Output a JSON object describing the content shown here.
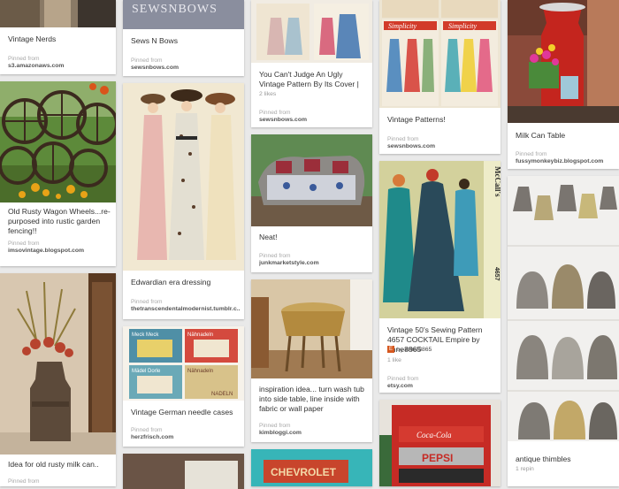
{
  "pins": {
    "vintage_nerds": {
      "description": "Vintage Nerds",
      "pinned_from": "Pinned from",
      "source": "s3.amazonaws.com"
    },
    "wagon_wheels": {
      "description": "Old Rusty Wagon Wheels...re-purposed into rustic garden fencing!!",
      "pinned_from": "Pinned from",
      "source": "imsovintage.blogspot.com"
    },
    "milk_can": {
      "description": "Idea for old rusty milk can..",
      "pinned_from": "Pinned from"
    },
    "sews_n_bows": {
      "image_text": "SEWSNBOWS",
      "description": "Sews N Bows",
      "pinned_from": "Pinned from",
      "source": "sewsnbows.com"
    },
    "edwardian": {
      "description": "Edwardian era dressing",
      "pinned_from": "Pinned from",
      "source": "thetranscendentalmodernist.tumblr.c..."
    },
    "needle_cases": {
      "image_labels": [
        "Meck Meck",
        "Nähnadeln",
        "Mädel Dorle",
        "Nähnadeln",
        "NADELN"
      ],
      "description": "Vintage German needle cases",
      "pinned_from": "Pinned from",
      "source": "herzfrisch.com"
    },
    "ugly_pattern": {
      "description": "You Can't Judge An Ugly Vintage Pattern By Its Cover |",
      "likes": "2 likes",
      "pinned_from": "Pinned from",
      "source": "sewsnbows.com"
    },
    "neat": {
      "description": "Neat!",
      "pinned_from": "Pinned from",
      "source": "junkmarketstyle.com"
    },
    "wash_tub": {
      "description": "inspiration idea... turn wash tub into side table, line inside with fabric or wall paper",
      "pinned_from": "Pinned from",
      "source": "kimbloggi.com"
    },
    "chevrolet": {
      "image_text": "CHEVROLET"
    },
    "vintage_patterns": {
      "image_labels": [
        "Simplicity",
        "Simplicity"
      ],
      "description": "Vintage Patterns!",
      "pinned_from": "Pinned from",
      "source": "sewsnbows.com"
    },
    "mccalls": {
      "image_text": "McCall's",
      "image_number": "4657",
      "description": "Vintage 50's Sewing Pattern 4657 COCKTAIL Empire by anne8865",
      "by_prefix": "by",
      "user": "anne8865",
      "likes": "1 like",
      "pinned_from": "Pinned from",
      "source": "etsy.com"
    },
    "coca_cola": {
      "image_labels": [
        "Coca-Cola",
        "PEPSI"
      ]
    },
    "milk_can_table": {
      "description": "Milk Can Table",
      "pinned_from": "Pinned from",
      "source": "fussymonkeybiz.blogspot.com"
    },
    "thimbles": {
      "description": "antique thimbles",
      "repins": "1 repin"
    }
  },
  "colors": {
    "page_bg": "#e9e9e9",
    "card_bg": "#ffffff",
    "source_text": "#555555",
    "meta_text": "#999999",
    "avatar": "#d6581f"
  }
}
